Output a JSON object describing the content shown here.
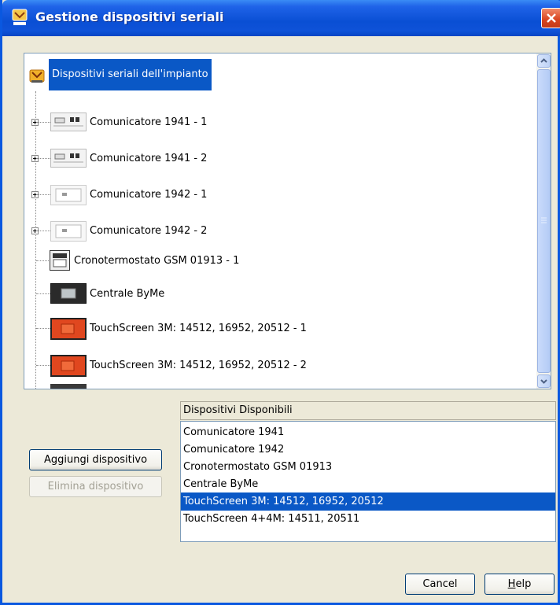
{
  "window": {
    "title": "Gestione dispositivi seriali",
    "colors": {
      "titlebar": "#0a4fd4",
      "selection": "#0a58c6",
      "close": "#d8431e"
    }
  },
  "tree": {
    "root": {
      "label": "Dispositivi seriali dell'impianto",
      "icon": "plant-icon",
      "selected": true
    },
    "items": [
      {
        "label": "Comunicatore 1941 - 1",
        "expandable": true,
        "icon": "comunicatore-1941-icon"
      },
      {
        "label": "Comunicatore 1941 - 2",
        "expandable": true,
        "icon": "comunicatore-1941-icon"
      },
      {
        "label": "Comunicatore 1942 - 1",
        "expandable": true,
        "icon": "comunicatore-1942-icon"
      },
      {
        "label": "Comunicatore 1942 - 2",
        "expandable": true,
        "icon": "comunicatore-1942-icon"
      },
      {
        "label": "Cronotermostato GSM 01913 - 1",
        "expandable": false,
        "icon": "cronotermostato-icon"
      },
      {
        "label": "Centrale ByMe",
        "expandable": false,
        "icon": "centrale-icon"
      },
      {
        "label": "TouchScreen 3M: 14512, 16952, 20512 - 1",
        "expandable": false,
        "icon": "touchscreen-icon"
      },
      {
        "label": "TouchScreen 3M: 14512, 16952, 20512 - 2",
        "expandable": false,
        "icon": "touchscreen-icon"
      }
    ]
  },
  "available": {
    "header": "Dispositivi Disponibili",
    "items": [
      "Comunicatore 1941",
      "Comunicatore 1942",
      "Cronotermostato GSM 01913",
      "Centrale ByMe",
      "TouchScreen 3M: 14512, 16952, 20512",
      "TouchScreen 4+4M: 14511, 20511"
    ],
    "selected_index": 4
  },
  "buttons": {
    "add": "Aggiungi dispositivo",
    "remove": "Elimina dispositivo",
    "cancel": "Cancel",
    "help": "Help"
  }
}
